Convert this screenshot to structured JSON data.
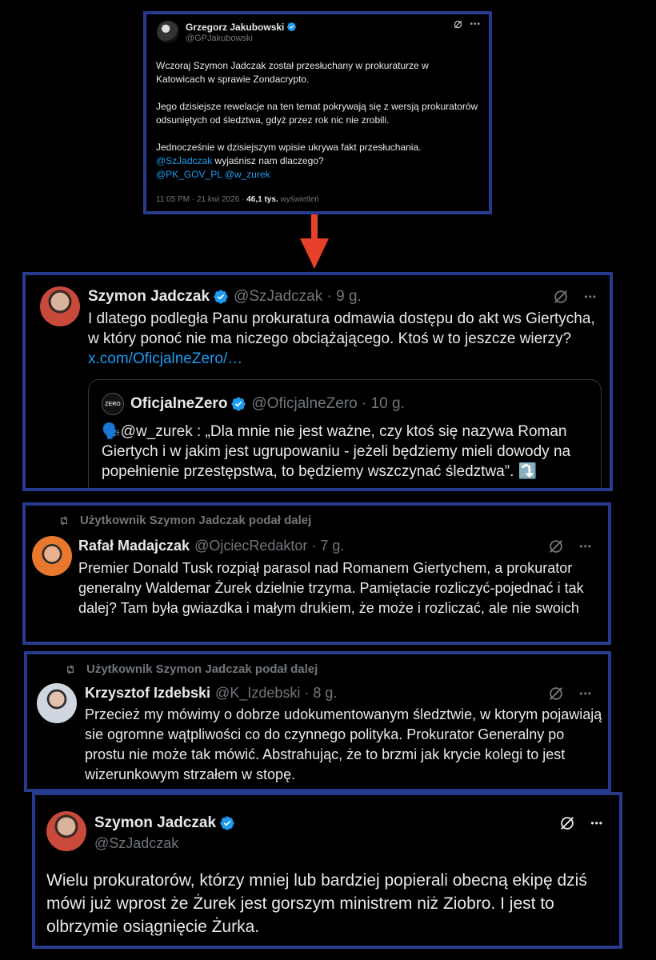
{
  "tweet1": {
    "name": "Grzegorz Jakubowski",
    "handle": "@GPJakubowski",
    "para1": "Wczoraj Szymon Jadczak został przesłuchany w prokuraturze w Katowicach w sprawie Zondacrypto.",
    "para2": "Jego dzisiejsze rewelacje na ten temat pokrywają się z wersją prokuratorów odsuniętych od śledztwa, gdyż przez rok nic nie zrobili.",
    "para3": "Jednocześnie w dzisiejszym wpisie ukrywa fakt przesłuchania.",
    "mention1": "@SzJadczak",
    "mention1_rest": " wyjaśnisz nam dlaczego?",
    "mention2": "@PK_GOV_PL @w_zurek",
    "time": "11:05 PM · 21 kwi 2026 · ",
    "views_count": "46,1 tys.",
    "views_label": " wyświetleń"
  },
  "tweet2": {
    "name": "Szymon Jadczak",
    "handle": "@SzJadczak · 9 g.",
    "text": "I dlatego podległa Panu prokuratura odmawia dostępu do akt ws Giertycha, w który ponoć nie ma niczego obciążającego. Ktoś w to jeszcze wierzy?",
    "link": "x.com/OficjalneZero/…",
    "quote": {
      "avatar_text": "ZERO",
      "name": "OficjalneZero",
      "handle": "@OficjalneZero · 10 g.",
      "emoji": "🗣️",
      "text": "@w_zurek : „Dla mnie nie jest ważne, czy ktoś się nazywa Roman Giertych i w jakim jest ugrupowaniu - jeżeli będziemy mieli dowody na popełnienie przestępstwa, to będziemy wszczynać śledztwa”. ⤵️"
    }
  },
  "tweet3": {
    "repost": "Użytkownik Szymon Jadczak podał dalej",
    "name": "Rafał Madajczak",
    "handle": "@OjciecRedaktor · 7 g.",
    "text": "Premier Donald Tusk rozpiął parasol nad Romanem Giertychem, a prokurator generalny Waldemar Żurek dzielnie trzyma. Pamiętacie rozliczyć-pojednać i tak dalej? Tam była gwiazdka i małym drukiem, że może i rozliczać, ale nie swoich"
  },
  "tweet4": {
    "repost": "Użytkownik Szymon Jadczak podał dalej",
    "name": "Krzysztof Izdebski",
    "handle": "@K_Izdebski · 8 g.",
    "text": "Przecież my mówimy o dobrze udokumentowanym śledztwie, w ktorym pojawiają sie ogromne wątpliwości co do czynnego polityka. Prokurator Generalny po prostu nie może tak mówić. Abstrahując, że to brzmi jak krycie kolegi to jest wizerunkowym strzałem w stopę."
  },
  "tweet5": {
    "name": "Szymon Jadczak",
    "handle": "@SzJadczak",
    "text": "Wielu prokuratorów, którzy mniej lub bardziej popierali obecną ekipę dziś mówi już wprost że Żurek jest gorszym ministrem niż Ziobro. I jest to olbrzymie osiągnięcie Żurka."
  },
  "icons": {
    "more": "•••",
    "grok": "grok-icon",
    "verified": "verified-badge-icon",
    "repost": "repost-icon",
    "arrow": "arrow-down-icon"
  },
  "colors": {
    "border": "#273a8c",
    "accent": "#1d9bf0",
    "arrow": "#e8412b",
    "muted": "#71767b"
  }
}
